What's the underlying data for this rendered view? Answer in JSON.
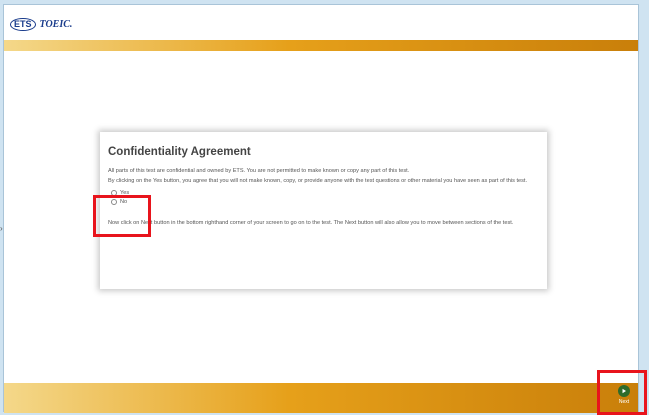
{
  "header": {
    "ets_badge": "ETS",
    "brand": "TOEIC."
  },
  "dialog": {
    "title": "Confidentiality Agreement",
    "paragraph1": "All parts of this test are confidential and owned by ETS. You are not permitted to make known or copy any part of this test.",
    "paragraph2": "By clicking on the Yes button, you agree that you will not make known, copy, or provide anyone with the test questions or other material you have seen as part of this test.",
    "options": [
      "Yes",
      "No"
    ],
    "paragraph3": "Now click on Next button in the bottom righthand corner of your screen to go on to the test. The Next button will also allow you to move between sections of the test."
  },
  "nav": {
    "next_label": "Next"
  },
  "colors": {
    "highlight": "#e8141c",
    "bar": "#e6a01a",
    "next": "#2f6b2a",
    "brand": "#1a3c8c"
  },
  "icons": {
    "side": "chevron-right-icon",
    "next": "play-circle-icon"
  }
}
